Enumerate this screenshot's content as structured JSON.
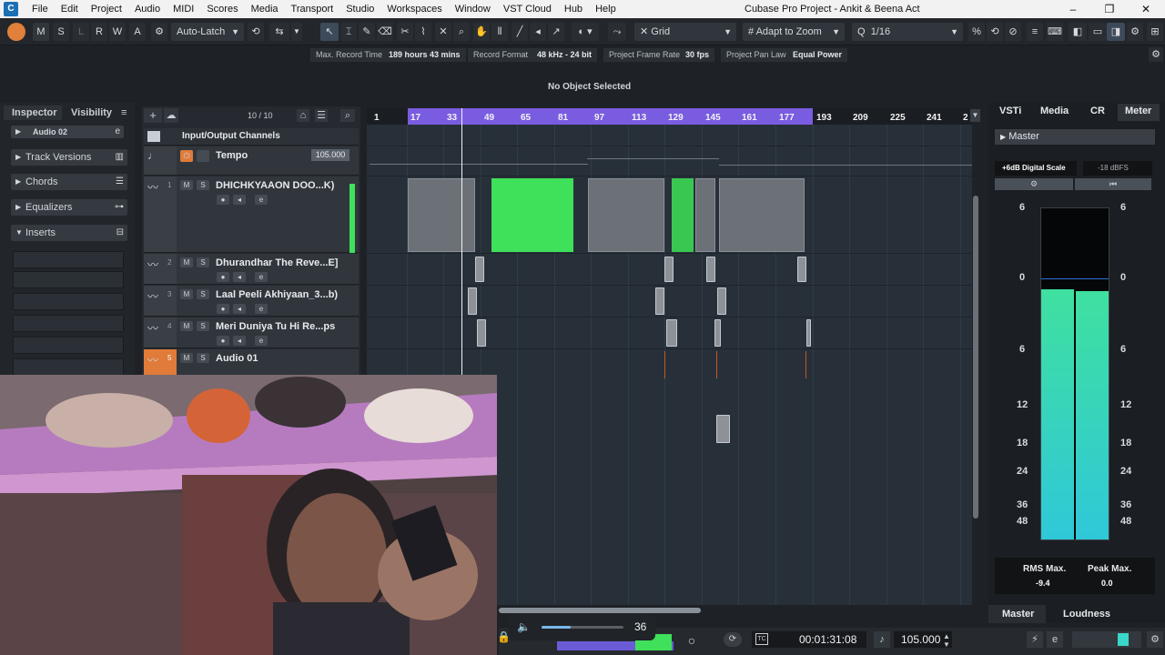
{
  "title_bar": {
    "menu": [
      "File",
      "Edit",
      "Project",
      "Audio",
      "MIDI",
      "Scores",
      "Media",
      "Transport",
      "Studio",
      "Workspaces",
      "Window",
      "VST Cloud",
      "Hub",
      "Help"
    ],
    "window_title": "Cubase Pro Project - Ankit & Beena Act",
    "min_icon": "–",
    "restore_icon": "❐",
    "close_icon": "✕"
  },
  "toolbar": {
    "mode_buttons": [
      "M",
      "S",
      "L",
      "R",
      "W",
      "A"
    ],
    "automation_mode": "Auto-Latch",
    "grid_type": "Grid",
    "zoom_mode": "Adapt to Zoom",
    "quantize": "1/16"
  },
  "info_line": {
    "max_record_time_label": "Max. Record Time",
    "max_record_time_value": "189 hours 43 mins",
    "record_format_label": "Record Format",
    "record_format_value": "48 kHz - 24 bit",
    "frame_rate_label": "Project Frame Rate",
    "frame_rate_value": "30 fps",
    "pan_law_label": "Project Pan Law",
    "pan_law_value": "Equal Power"
  },
  "status": "No Object Selected",
  "left_zone": {
    "tabs": [
      "Inspector",
      "Visibility"
    ],
    "track_name": "Audio 02",
    "sections": [
      "Track Versions",
      "Chords",
      "Equalizers",
      "Inserts"
    ]
  },
  "track_list": {
    "count": "10 / 10",
    "folder_name": "Input/Output Channels",
    "tempo_label": "Tempo",
    "tempo_value": "105.000",
    "tracks": [
      {
        "num": "1",
        "name": "DHICHKYAAON DOO...K)"
      },
      {
        "num": "2",
        "name": "Dhurandhar The Reve...E]"
      },
      {
        "num": "3",
        "name": "Laal Peeli Akhiyaan_3...b)"
      },
      {
        "num": "4",
        "name": "Meri Duniya Tu Hi Re...ps"
      },
      {
        "num": "5",
        "name": "Audio 01"
      }
    ]
  },
  "ruler": [
    "1",
    "17",
    "33",
    "49",
    "65",
    "81",
    "97",
    "113",
    "129",
    "145",
    "161",
    "177",
    "193",
    "209",
    "225",
    "241",
    "2"
  ],
  "right_zone": {
    "tabs": [
      "VSTi",
      "Media",
      "CR",
      "Meter"
    ],
    "master_label": "Master",
    "digital_scale": "+6dB Digital Scale",
    "dbfs": "-18 dBFS",
    "scale": [
      "6",
      "0",
      "6",
      "12",
      "18",
      "24",
      "36",
      "48"
    ],
    "rms_label": "RMS Max.",
    "rms_value": "-9.4",
    "peak_label": "Peak Max.",
    "peak_value": "0.0",
    "bottom_tabs": [
      "Master",
      "Loudness"
    ]
  },
  "transport": {
    "time": "00:01:31:08",
    "tempo": "105.000",
    "volume_value": "36"
  },
  "colors": {
    "accent": "#7a5ce0",
    "green": "#3fe05a",
    "meter": "#3ad6c8",
    "record": "#e07b3a"
  }
}
